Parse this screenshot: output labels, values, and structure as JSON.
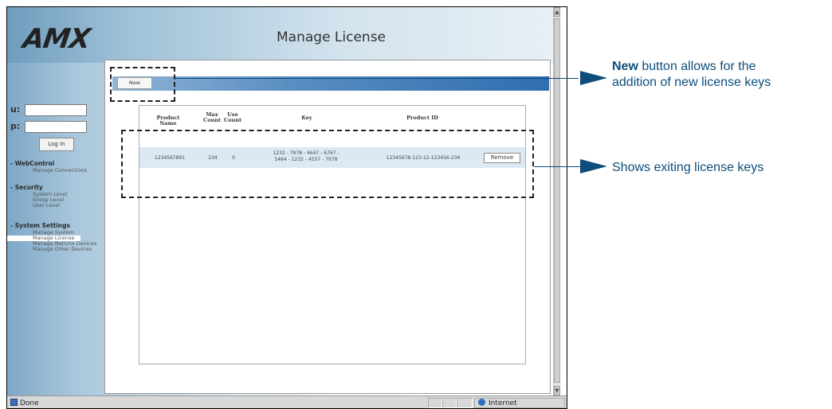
{
  "brand": {
    "logo_text": "AMX"
  },
  "header": {
    "title": "Manage License"
  },
  "login": {
    "user_label": "u:",
    "pass_label": "p:",
    "button_label": "Log In"
  },
  "sidebar": {
    "groups": [
      {
        "title": "- WebControl",
        "items": [
          "Manage Connections"
        ]
      },
      {
        "title": "- Security",
        "items": [
          "System Level",
          "Group Level",
          "User Level"
        ]
      },
      {
        "title": "- System Settings",
        "items": [
          "Manage System",
          "Manage License",
          "Manage NetLinx Devices",
          "Manage Other Devices"
        ]
      }
    ],
    "active_item": "Manage License"
  },
  "toolbar": {
    "new_label": "New"
  },
  "table": {
    "headers": [
      "Product Name",
      "Max Count",
      "Use Count",
      "Key",
      "Product ID"
    ],
    "header_lines": {
      "max": [
        "Max",
        "Count"
      ],
      "use": [
        "Use",
        "Count"
      ]
    },
    "rows": [
      {
        "product_name": "1234567891",
        "max_count": "234",
        "use_count": "0",
        "key_line1": "1232 - 7978 - 4647 - 6767 -",
        "key_line2": "5464 - 1232 - 4557 - 7978",
        "product_id": "12345678-123-12-123456-234",
        "action_label": "Remove"
      }
    ]
  },
  "statusbar": {
    "status_text": "Done",
    "zone_text": "Internet"
  },
  "annotations": {
    "new": {
      "bold": "New",
      "line1_rest": " button allows for the",
      "line2": "addition of new license keys"
    },
    "table": {
      "text": "Shows exiting license keys"
    }
  },
  "colors": {
    "annotation": "#0e4d7a",
    "row_highlight": "#dce9f5",
    "toolbar_strip": "#2f6eb0"
  }
}
